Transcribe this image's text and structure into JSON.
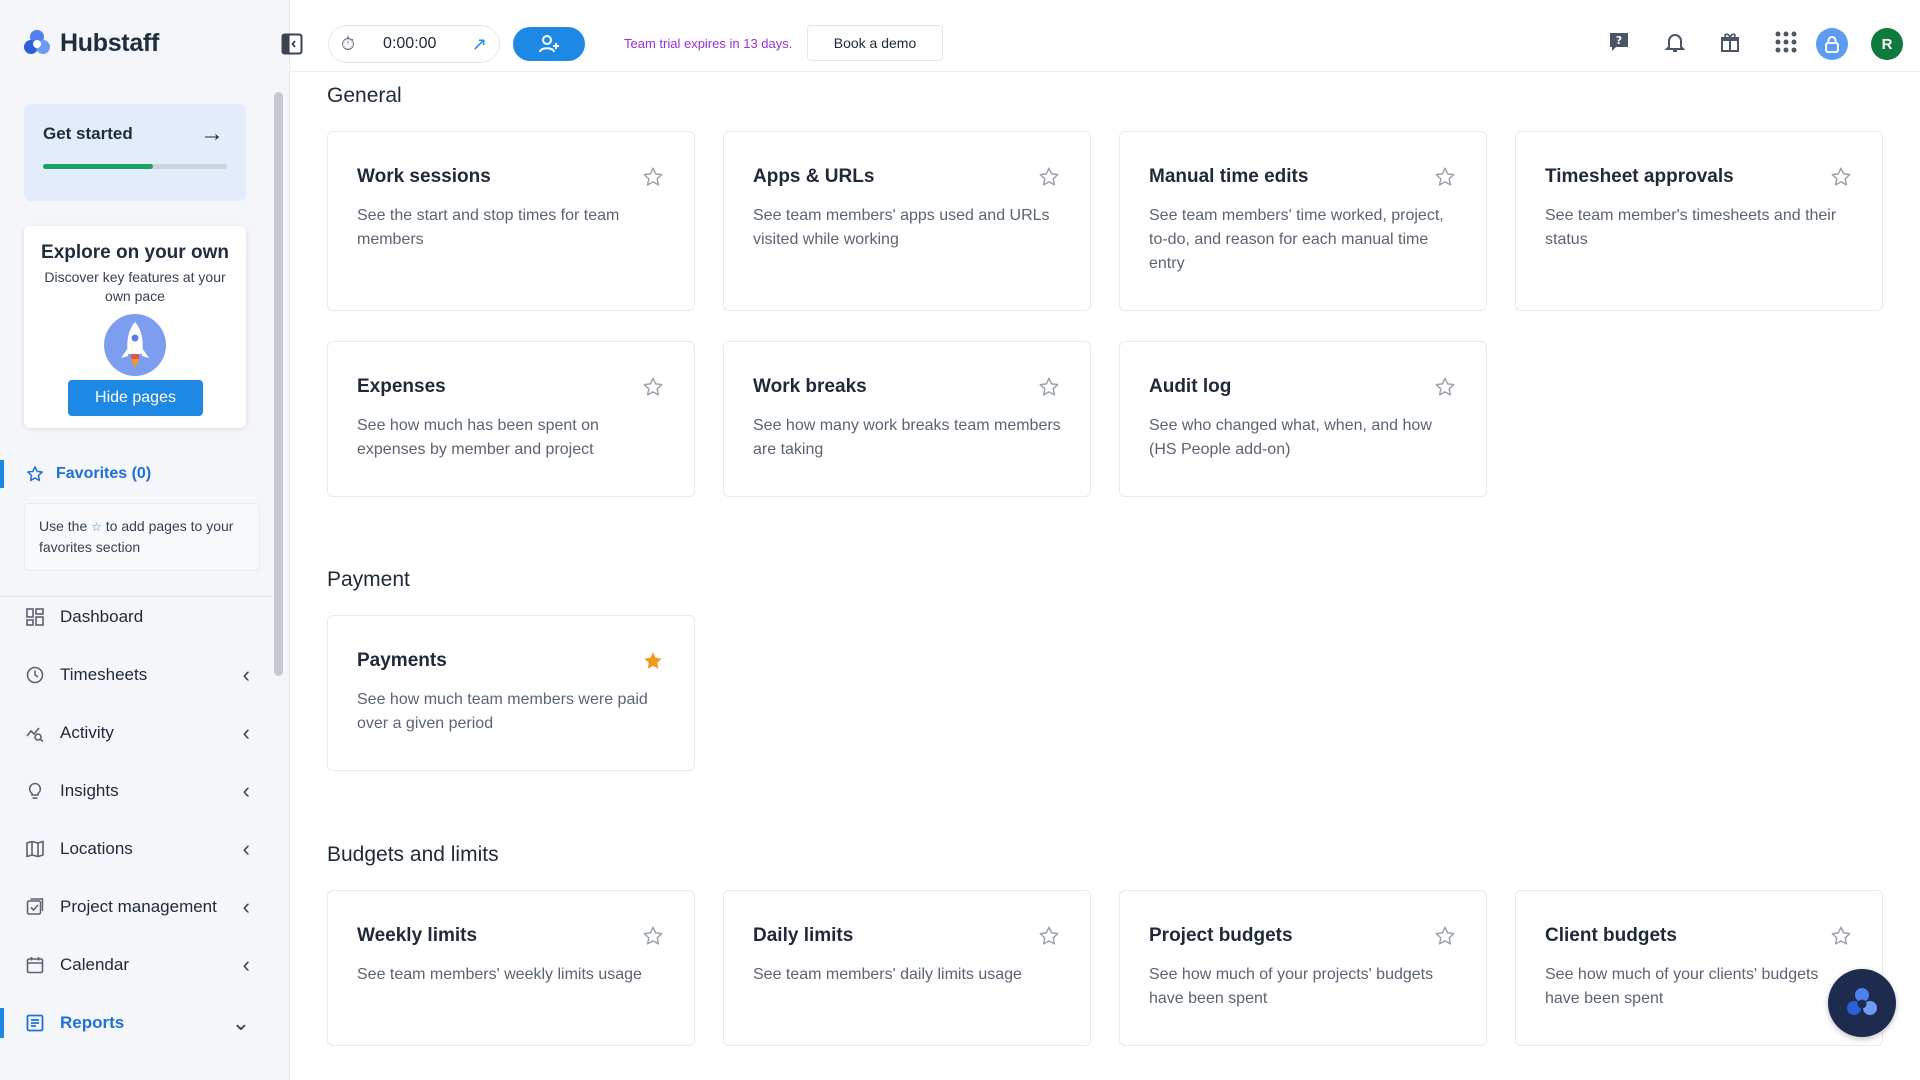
{
  "app": {
    "name": "Hubstaff"
  },
  "sidebar": {
    "get_started": {
      "label": "Get started",
      "progress_percent": 60
    },
    "explore": {
      "title": "Explore on your own",
      "subtitle": "Discover key features at your own pace",
      "hide_button": "Hide pages"
    },
    "favorites": {
      "label": "Favorites (0)",
      "note_before": "Use the",
      "note_after": "to add pages to your favorites section"
    },
    "nav": [
      {
        "label": "Dashboard",
        "icon": "dashboard-icon",
        "has_chevron": false
      },
      {
        "label": "Timesheets",
        "icon": "clock-icon",
        "has_chevron": true
      },
      {
        "label": "Activity",
        "icon": "activity-icon",
        "has_chevron": true
      },
      {
        "label": "Insights",
        "icon": "lightbulb-icon",
        "has_chevron": true
      },
      {
        "label": "Locations",
        "icon": "map-icon",
        "has_chevron": true
      },
      {
        "label": "Project management",
        "icon": "checklist-icon",
        "has_chevron": true
      },
      {
        "label": "Calendar",
        "icon": "calendar-icon",
        "has_chevron": true
      },
      {
        "label": "Reports",
        "icon": "reports-icon",
        "has_chevron": true,
        "active": true
      }
    ]
  },
  "topbar": {
    "timer_value": "0:00:00",
    "trial_text": "Team trial expires in 13 days.",
    "demo_button": "Book a demo",
    "user_initial": "R"
  },
  "sections": [
    {
      "title": "General",
      "cards": [
        {
          "title": "Work sessions",
          "desc": "See the start and stop times for team members",
          "favorite": false
        },
        {
          "title": "Apps & URLs",
          "desc": "See team members' apps used and URLs visited while working",
          "favorite": false
        },
        {
          "title": "Manual time edits",
          "desc": "See team members' time worked, project, to-do, and reason for each manual time entry",
          "favorite": false
        },
        {
          "title": "Timesheet approvals",
          "desc": "See team member's timesheets and their status",
          "favorite": false
        },
        {
          "title": "Expenses",
          "desc": "See how much has been spent on expenses by member and project",
          "favorite": false
        },
        {
          "title": "Work breaks",
          "desc": "See how many work breaks team members are taking",
          "favorite": false
        },
        {
          "title": "Audit log",
          "desc": "See who changed what, when, and how (HS People add-on)",
          "favorite": false
        }
      ]
    },
    {
      "title": "Payment",
      "cards": [
        {
          "title": "Payments",
          "desc": "See how much team members were paid over a given period",
          "favorite": true
        }
      ]
    },
    {
      "title": "Budgets and limits",
      "cards": [
        {
          "title": "Weekly limits",
          "desc": "See team members' weekly limits usage",
          "favorite": false
        },
        {
          "title": "Daily limits",
          "desc": "See team members' daily limits usage",
          "favorite": false
        },
        {
          "title": "Project budgets",
          "desc": "See how much of your projects' budgets have been spent",
          "favorite": false
        },
        {
          "title": "Client budgets",
          "desc": "See how much of your clients' budgets have been spent",
          "favorite": false
        }
      ]
    }
  ],
  "colors": {
    "accent": "#1e88e5",
    "favorite_star": "#f29a1e",
    "trial_text": "#9b2fd6",
    "progress": "#19a463"
  }
}
